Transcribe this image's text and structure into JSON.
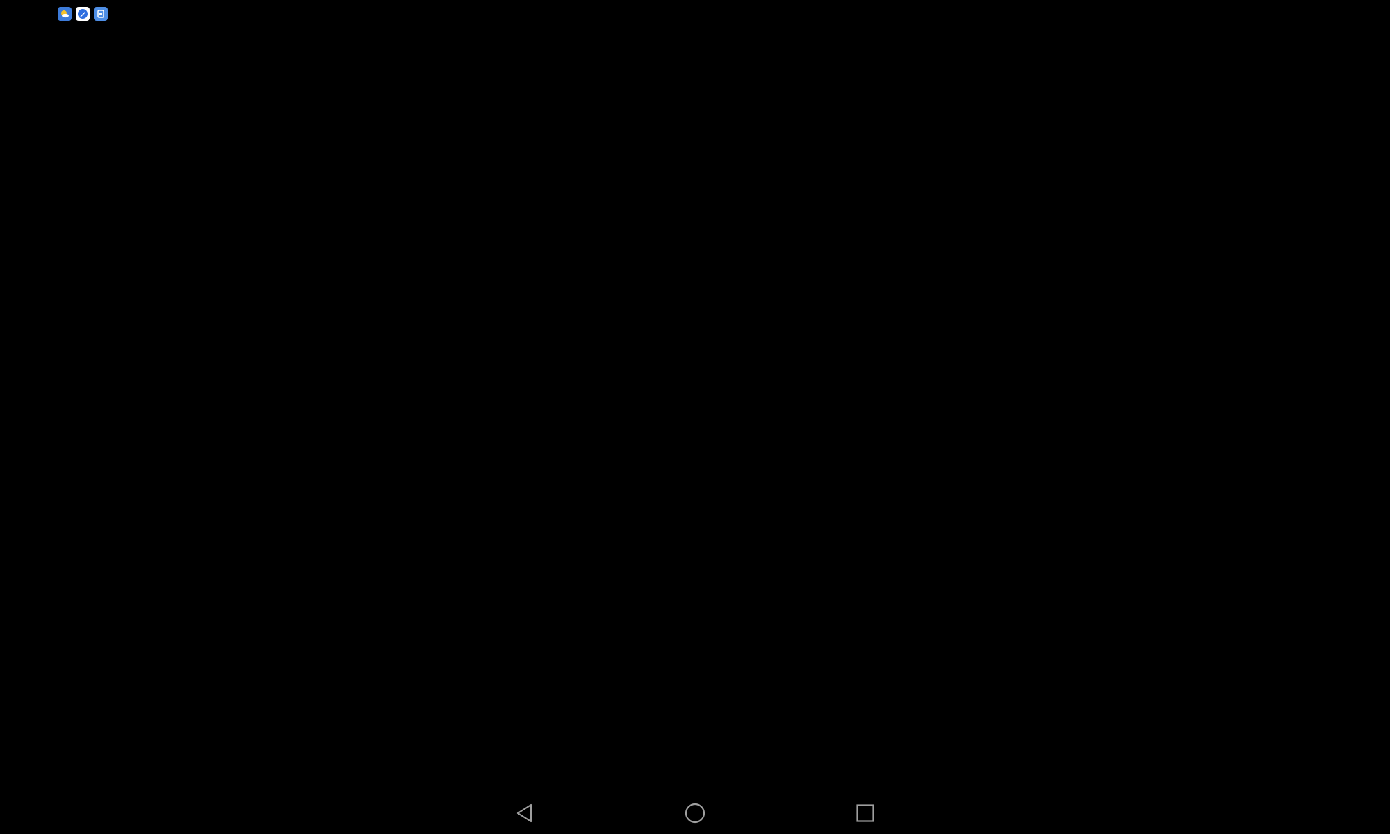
{
  "colors": {
    "background": "#000000",
    "nav_icon": "#9e9e9e",
    "weather_bg": "#3d7bd9",
    "weather_sun": "#f6c22a",
    "drive_bg": "#ffffff",
    "drive_accent": "#2f6fe0",
    "files_bg": "#4f8fe6"
  },
  "status_bar": {
    "notification_icons": [
      {
        "icon": "weather-icon"
      },
      {
        "icon": "edit-app-icon"
      },
      {
        "icon": "files-app-icon"
      }
    ]
  },
  "nav_bar": {
    "buttons": [
      {
        "icon": "back-triangle-icon"
      },
      {
        "icon": "home-circle-icon"
      },
      {
        "icon": "recents-square-icon"
      }
    ]
  }
}
